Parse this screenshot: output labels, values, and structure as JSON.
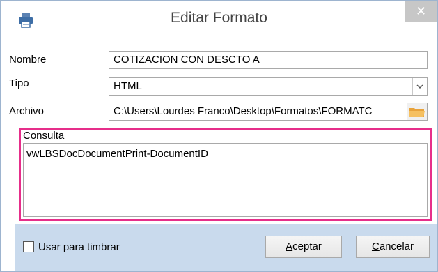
{
  "window": {
    "title": "Editar Formato",
    "close_glyph": "✕"
  },
  "form": {
    "nombre": {
      "label": "Nombre",
      "value": "COTIZACION CON DESCTO A"
    },
    "tipo": {
      "label": "Tipo",
      "value": "HTML"
    },
    "archivo": {
      "label": "Archivo",
      "value": "C:\\Users\\Lourdes Franco\\Desktop\\Formatos\\FORMATC"
    },
    "consulta": {
      "label": "Consulta",
      "value": "vwLBSDocDocumentPrint-DocumentID"
    }
  },
  "footer": {
    "checkbox_label": "Usar para timbrar",
    "aceptar_first": "A",
    "aceptar_rest": "ceptar",
    "cancelar_first": "C",
    "cancelar_rest": "ancelar"
  },
  "colors": {
    "highlight": "#e62e8a",
    "footer_bg": "#c9daed"
  }
}
